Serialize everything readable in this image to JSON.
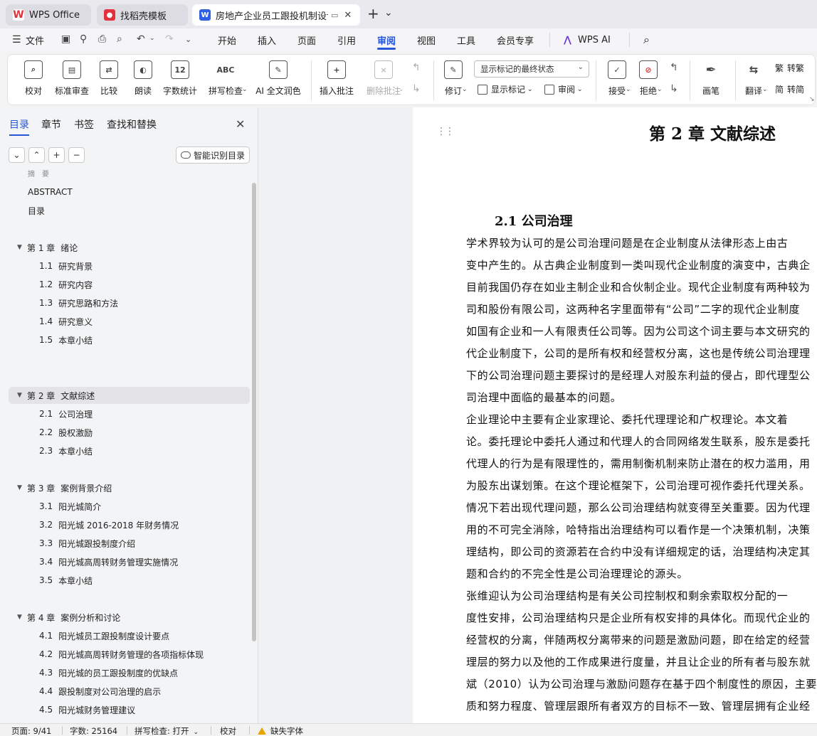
{
  "tabs": [
    {
      "label": "WPS Office",
      "icon": "wps-logo-icon",
      "color": "#e2303d"
    },
    {
      "label": "找稻壳模板",
      "icon": "docer-icon",
      "color": "#e2303d"
    },
    {
      "label": "房地产企业员工跟投机制设计",
      "icon": "word-doc-icon",
      "color": "#2f5fe5"
    }
  ],
  "tabbar": {
    "new_tab": "+",
    "tab_menu": "⌄",
    "close": "✕",
    "monitor_icon": "monitor-icon"
  },
  "menu": {
    "file": "文件",
    "items": [
      "开始",
      "插入",
      "页面",
      "引用",
      "审阅",
      "视图",
      "工具",
      "会员专享",
      "WPS AI"
    ],
    "active": "审阅"
  },
  "ribbon": {
    "proofread": "校对",
    "std_review": "标准审查",
    "compare": "比较",
    "read_aloud": "朗读",
    "word_count": "字数统计",
    "spell_check": "拼写检查",
    "ai_polish": "AI 全文润色",
    "insert_comment": "插入批注",
    "delete_comment": "删除批注",
    "revise": "修订",
    "markup_select": "显示标记的最终状态",
    "show_markup": "显示标记",
    "review": "审阅",
    "accept": "接受",
    "reject": "拒绝",
    "pen": "画笔",
    "translate": "翻译",
    "to_traditional": "转繁",
    "to_simplified": "转简",
    "icon_text_wordcount": "12",
    "icon_text_spell": "ABC"
  },
  "panel": {
    "tabs": [
      "目录",
      "章节",
      "书签",
      "查找和替换"
    ],
    "active_tab": "目录",
    "close": "✕",
    "controls": [
      "⌄",
      "⌃",
      "+",
      "−"
    ],
    "smart_toc": "智能识别目录"
  },
  "toc": [
    {
      "level": 1,
      "num": "",
      "text": "ABSTRACT"
    },
    {
      "level": 1,
      "num": "",
      "text": "目录"
    },
    {
      "level": 1,
      "num": "第 1 章",
      "text": "绪论",
      "expanded": true
    },
    {
      "level": 2,
      "num": "1.1",
      "text": "研究背景"
    },
    {
      "level": 2,
      "num": "1.2",
      "text": "研究内容"
    },
    {
      "level": 2,
      "num": "1.3",
      "text": "研究思路和方法"
    },
    {
      "level": 2,
      "num": "1.4",
      "text": "研究意义"
    },
    {
      "level": 2,
      "num": "1.5",
      "text": "本章小结"
    },
    {
      "level": 1,
      "num": "第 2 章",
      "text": "文献综述",
      "expanded": true,
      "selected": true
    },
    {
      "level": 2,
      "num": "2.1",
      "text": "公司治理"
    },
    {
      "level": 2,
      "num": "2.2",
      "text": "股权激励"
    },
    {
      "level": 2,
      "num": "2.3",
      "text": "本章小结"
    },
    {
      "level": 1,
      "num": "第 3 章",
      "text": "案例背景介绍",
      "expanded": true
    },
    {
      "level": 2,
      "num": "3.1",
      "text": "阳光城简介"
    },
    {
      "level": 2,
      "num": "3.2",
      "text": "阳光城 2016-2018 年财务情况"
    },
    {
      "level": 2,
      "num": "3.3",
      "text": "阳光城跟投制度介绍"
    },
    {
      "level": 2,
      "num": "3.4",
      "text": "阳光城高周转财务管理实施情况"
    },
    {
      "level": 2,
      "num": "3.5",
      "text": "本章小结"
    },
    {
      "level": 1,
      "num": "第 4 章",
      "text": "案例分析和讨论",
      "expanded": true
    },
    {
      "level": 2,
      "num": "4.1",
      "text": "阳光城员工跟投制度设计要点"
    },
    {
      "level": 2,
      "num": "4.2",
      "text": "阳光城高周转财务管理的各项指标体现"
    },
    {
      "level": 2,
      "num": "4.3",
      "text": "阳光城的员工跟投制度的优缺点"
    },
    {
      "level": 2,
      "num": "4.4",
      "text": "跟投制度对公司治理的启示"
    },
    {
      "level": 2,
      "num": "4.5",
      "text": "阳光城财务管理建议"
    }
  ],
  "doc": {
    "chapter_title": "第 2 章  文献综述",
    "section_title": "2.1  公司治理",
    "lines": [
      "    学术界较为认可的是公司治理问题是在企业制度从法律形态上由古",
      "变中产生的。从古典企业制度到一类叫现代企业制度的演变中，古典企",
      "目前我国仍存在如业主制企业和合伙制企业。现代企业制度有两种较为",
      "司和股份有限公司，这两种名字里面带有“公司”二字的现代企业制度",
      "如国有企业和一人有限责任公司等。因为公司这个词主要与本文研究的",
      "代企业制度下，公司的是所有权和经营权分离，这也是传统公司治理理",
      "下的公司治理问题主要探讨的是经理人对股东利益的侵占，即代理型公",
      "司治理中面临的最基本的问题。",
      "    企业理论中主要有企业家理论、委托代理理论和广权理论。本文着",
      "论。委托理论中委托人通过和代理人的合同网络发生联系，股东是委托",
      "代理人的行为是有限理性的，需用制衡机制来防止潜在的权力滥用，用",
      "为股东出谋划策。在这个理论框架下，公司治理可视作委托代理关系。",
      "情况下若出现代理问题，那么公司治理结构就变得至关重要。因为代理",
      "用的不可完全消除，哈特指出治理结构可以看作是一个决策机制，决策",
      "理结构，即公司的资源若在合约中没有详细规定的话，治理结构决定其",
      "题和合约的不完全性是公司治理理论的源头。",
      "    张维迎认为公司治理结构是有关公司控制权和剩余索取权分配的一",
      "度性安排，公司治理结构只是企业所有权安排的具体化。而现代企业的",
      "经营权的分离，伴随两权分离带来的问题是激励问题，即在给定的经营",
      "理层的努力以及他的工作成果进行度量，并且让企业的所有者与股东就",
      "斌（2010）认为公司治理与激励问题存在基于四个制度性的原因，主要",
      "质和努力程度、管理层跟所有者双方的目标不一致、管理层拥有企业经"
    ]
  },
  "status": {
    "page": "页面: 9/41",
    "words": "字数: 25164",
    "spell": "拼写检查: 打开",
    "proof": "校对",
    "missing_font": "缺失字体"
  }
}
